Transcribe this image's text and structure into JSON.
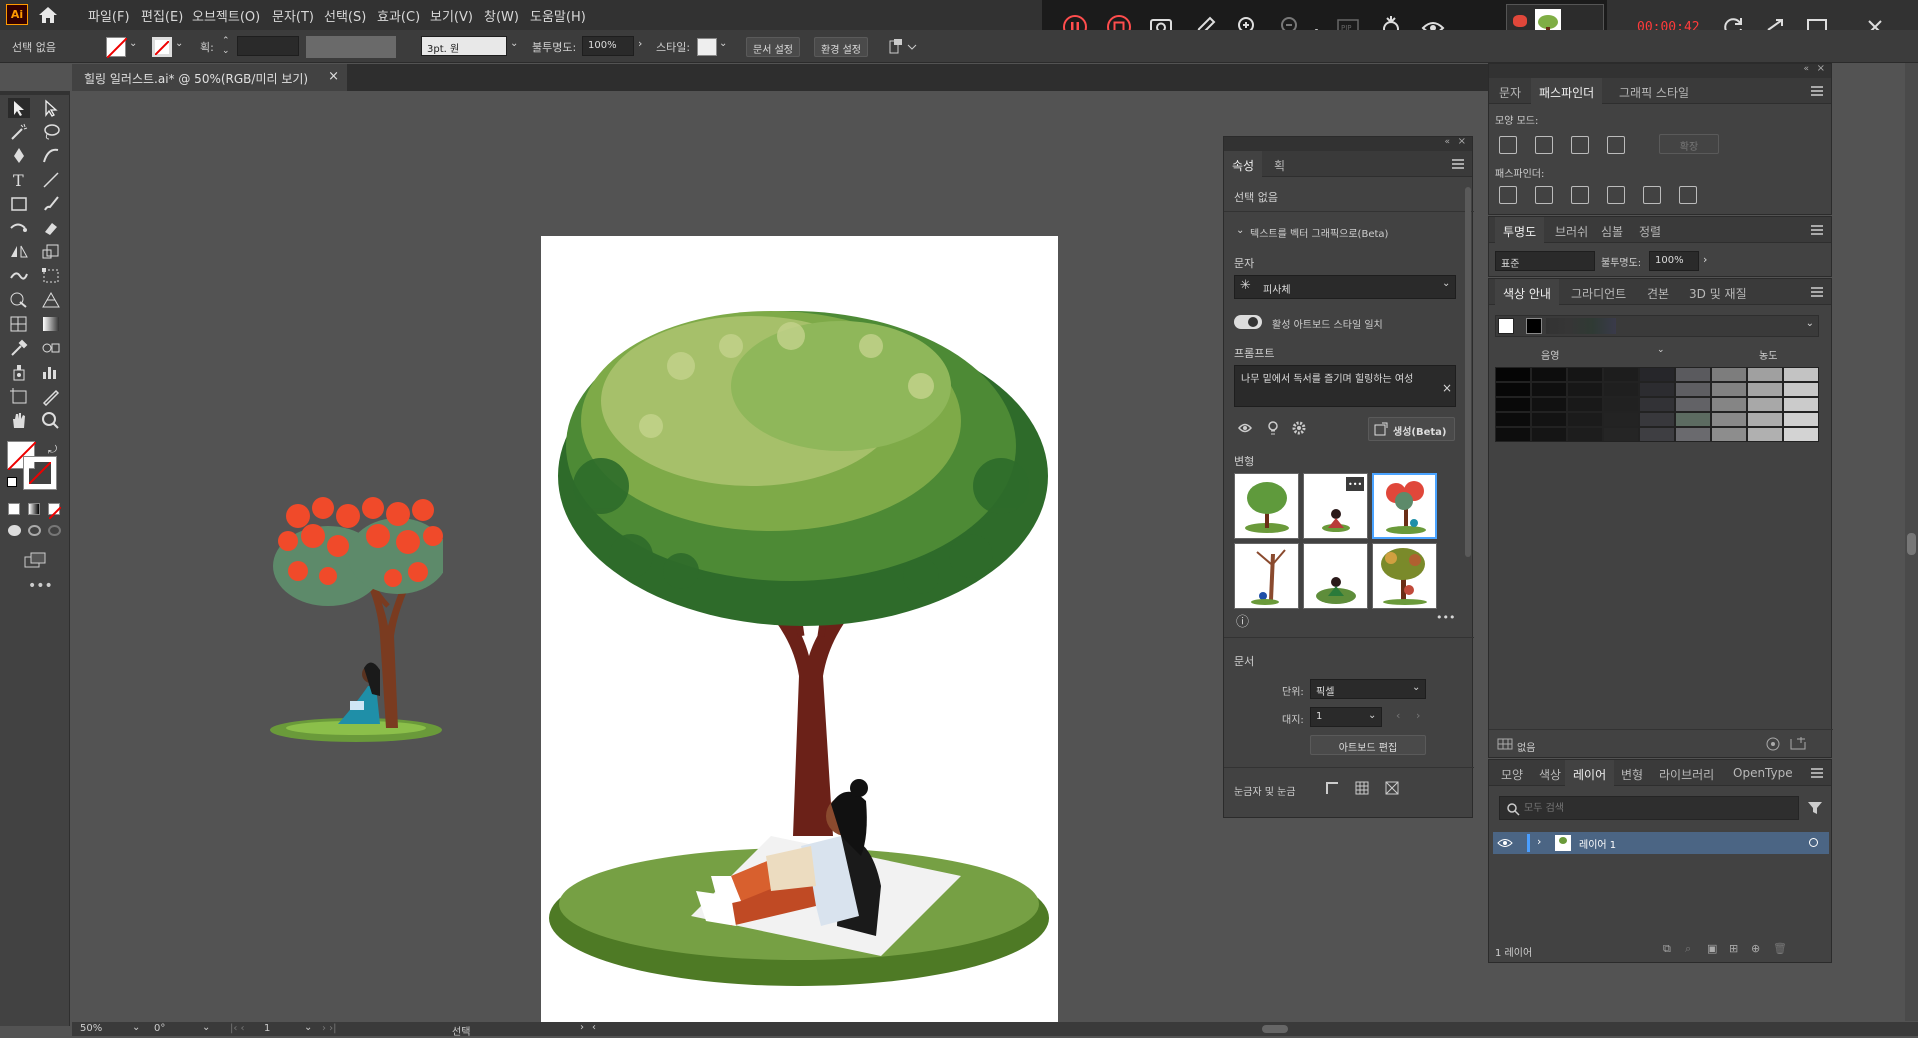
{
  "app": {
    "logo": "Ai"
  },
  "menu": [
    "파일(F)",
    "편집(E)",
    "오브젝트(O)",
    "문자(T)",
    "선택(S)",
    "효과(C)",
    "보기(V)",
    "창(W)",
    "도움말(H)"
  ],
  "control": {
    "selection": "선택 없음",
    "stroke_label": "획:",
    "stroke_size": "3pt. 원",
    "opacity_label": "불투명도:",
    "opacity_value": "100%",
    "style_label": "스타일:",
    "doc_setup": "문서 설정",
    "prefs": "환경 설정"
  },
  "recorder": {
    "time": "00:00:42",
    "zoom": "x1"
  },
  "document_tab": {
    "title": "힐링 일러스트.ai* @ 50%(RGB/미리 보기)",
    "close": "×"
  },
  "properties": {
    "tabs": [
      "속성",
      "획"
    ],
    "selection": "선택 없음",
    "section_title": "텍스트를 벡터 그래픽으로(Beta)",
    "subject_label": "문자",
    "subject_value": "피사체",
    "toggle_label": "활성 아트보드 스타일 일치",
    "prompt_label": "프롬프트",
    "prompt_text": "나무 밑에서 독서를 즐기며 힐링하는 여성",
    "generate": "생성(Beta)",
    "variations_label": "변형",
    "document_label": "문서",
    "unit_label": "단위:",
    "unit_value": "픽셀",
    "artboard_label": "대지:",
    "artboard_value": "1",
    "edit_artboard": "아트보드 편집",
    "rulers_label": "눈금자 및 눈금"
  },
  "right_top": {
    "tabs": [
      "문자",
      "패스파인더",
      "그래픽 스타일"
    ],
    "shape_mode": "모양 모드:",
    "expand": "확장",
    "pathfinder": "패스파인더:"
  },
  "transparency": {
    "tabs": [
      "투명도",
      "브러쉬",
      "심볼",
      "정렬"
    ],
    "mode": "표준",
    "opacity_label": "불투명도:",
    "opacity_value": "100%"
  },
  "color_guide": {
    "tabs": [
      "색상 안내",
      "그라디언트",
      "견본",
      "3D 및 재질"
    ],
    "shade": "음영",
    "tint": "농도",
    "none_label": "없음"
  },
  "layers": {
    "tabs": [
      "모양",
      "색상",
      "레이어",
      "변형",
      "라이브러리",
      "OpenType"
    ],
    "search_placeholder": "모두 검색",
    "layer_name": "레이어 1",
    "count": "1 레이어"
  },
  "status": {
    "zoom": "50%",
    "rotate": "0°",
    "artboard": "1",
    "tool": "선택"
  },
  "colors": {
    "accent": "#4a9eff",
    "record_red": "#ff3b3b"
  }
}
